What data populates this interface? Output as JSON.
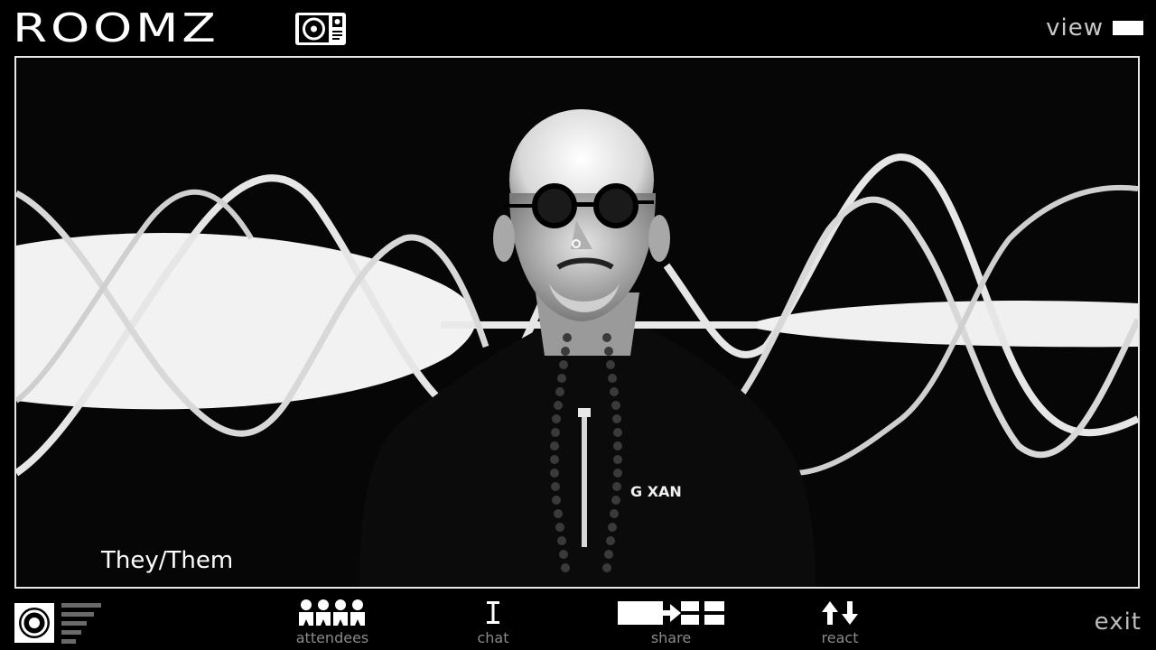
{
  "app": {
    "logo_text": "ROOMZ",
    "logo_icon": "turntable-icon"
  },
  "header": {
    "view_label": "view",
    "view_icon": "view-layout-icon"
  },
  "video": {
    "pronouns": "They/Them",
    "shirt_text": "G XAN"
  },
  "toolbar": {
    "self_camera_icon": "camera-target-icon",
    "level_icon": "signal-bars-icon",
    "attendees_label": "attendees",
    "chat_label": "chat",
    "share_label": "share",
    "react_label": "react",
    "exit_label": "exit"
  },
  "colors": {
    "background": "#000000",
    "foreground": "#ffffff",
    "muted": "#8a8a8a"
  }
}
